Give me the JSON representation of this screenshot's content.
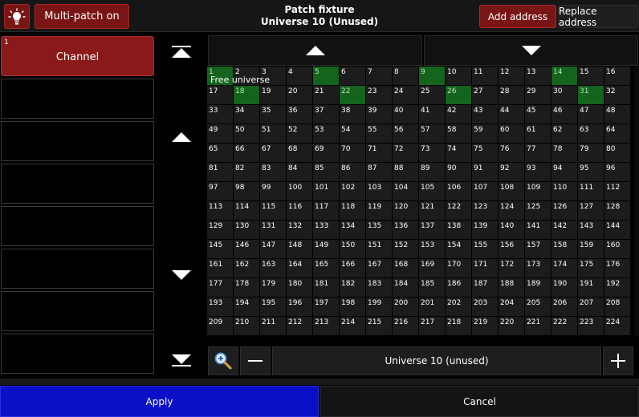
{
  "header": {
    "multipatch_label": "Multi-patch on",
    "title": "Patch fixture",
    "subtitle": "Universe 10 (Unused)",
    "add_address_label": "Add address",
    "replace_address_label": "Replace address"
  },
  "channel_list": {
    "selected": {
      "number": "1",
      "label": "Channel"
    }
  },
  "grid": {
    "overlay_label": "Free universe",
    "rows": 14,
    "columns": 16,
    "start": 1,
    "occupied": [
      1,
      5,
      9,
      14,
      18,
      22,
      26,
      31
    ]
  },
  "footer": {
    "universe_label": "Universe 10 (unused)",
    "apply_label": "Apply",
    "cancel_label": "Cancel"
  },
  "colors": {
    "accent_red": "#7a1515",
    "apply_blue": "#0a10c8",
    "occupied_green": "#14641e"
  }
}
